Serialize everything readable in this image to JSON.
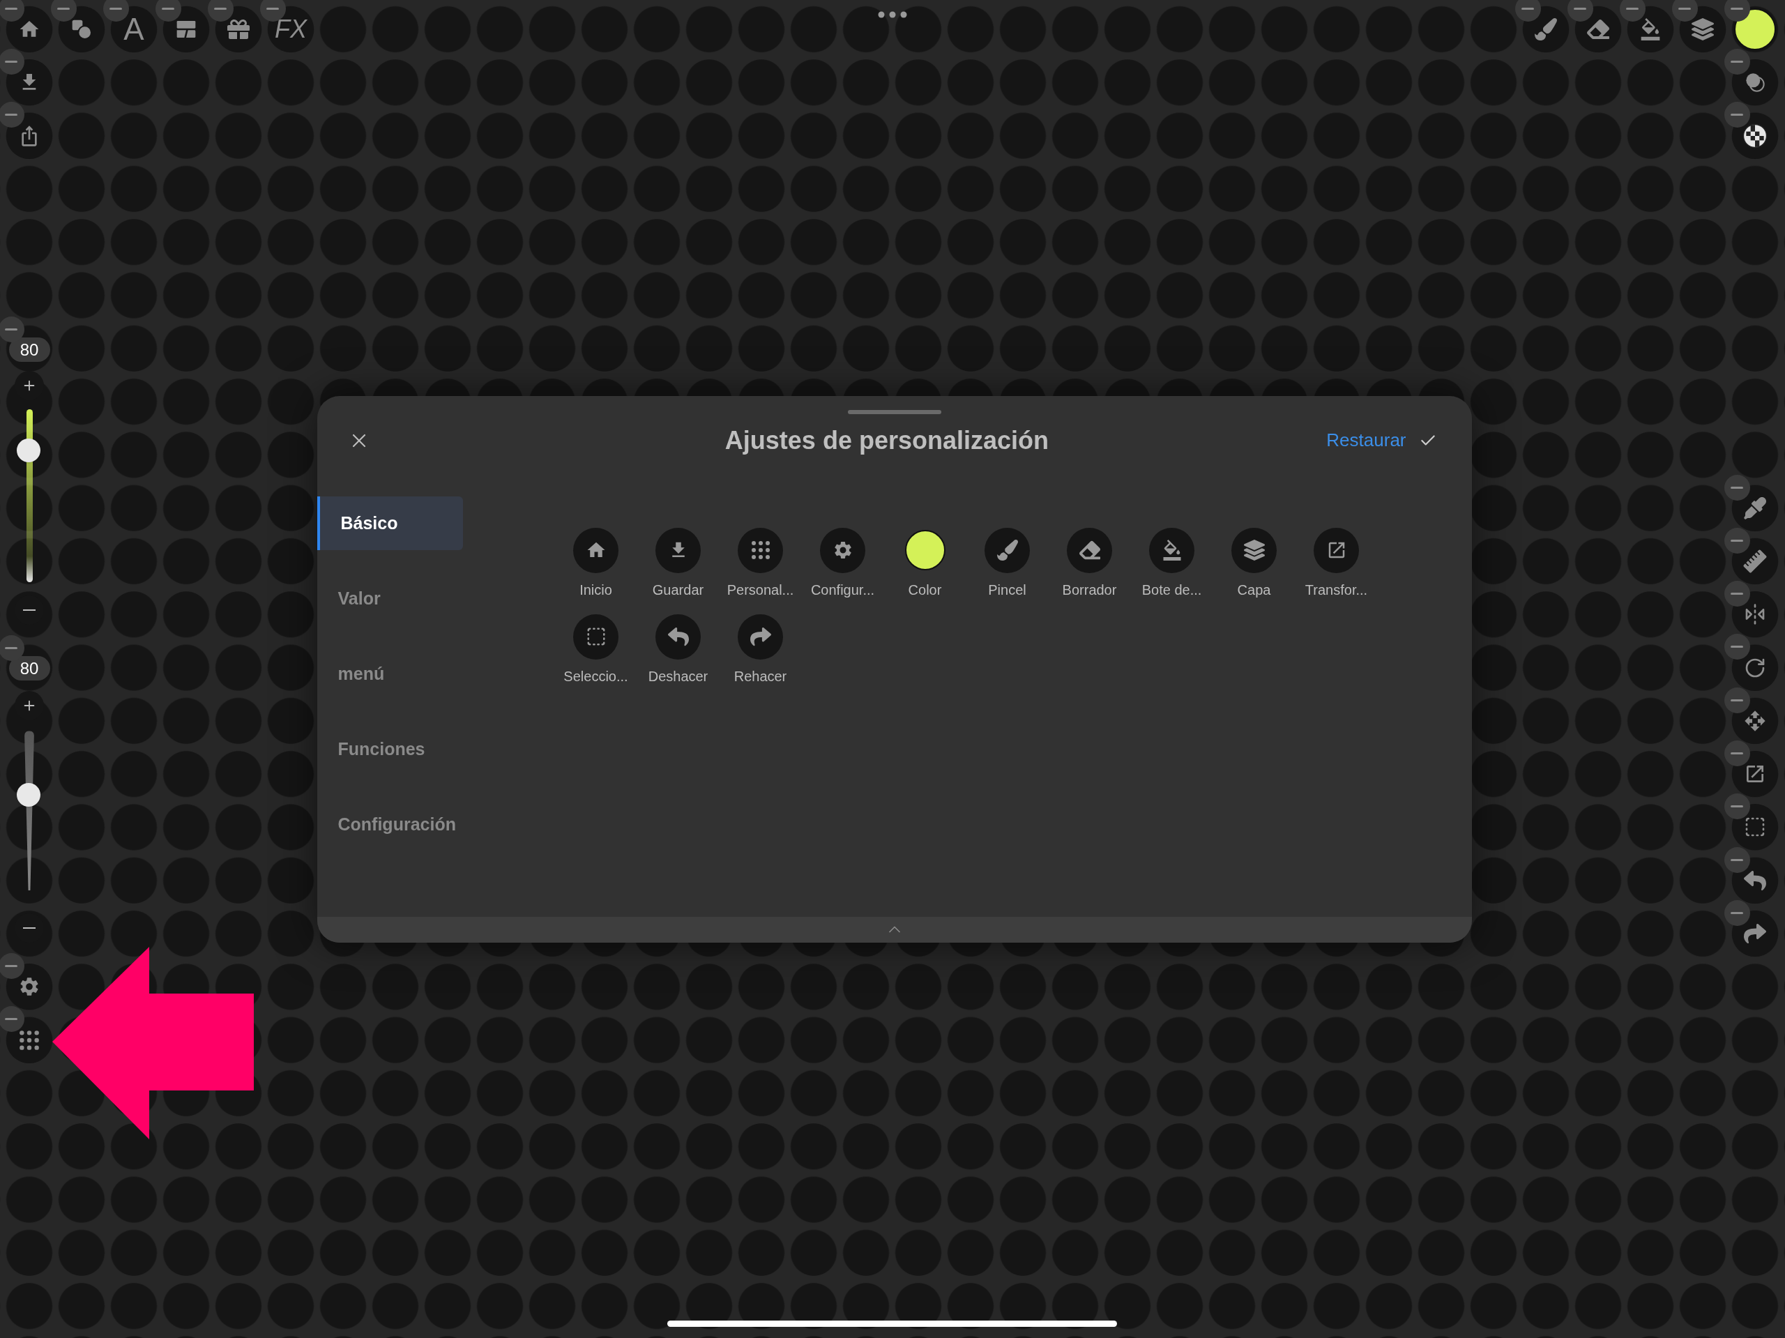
{
  "top_toolbar": {
    "text_tool": "A",
    "effects_tool": "FX",
    "swatch": {
      "color": "#d4f158"
    }
  },
  "left_toolbar": {
    "sliders": [
      {
        "kind": "size",
        "value": "80",
        "level": 0.76
      },
      {
        "kind": "opacity",
        "value": "80",
        "level": 0.6
      }
    ]
  },
  "dialog": {
    "title": "Ajustes de personalización",
    "reset": "Restaurar",
    "sidebar": [
      {
        "label": "Básico",
        "selected": true
      },
      {
        "label": "Valor",
        "selected": false
      },
      {
        "label": "menú",
        "selected": false
      },
      {
        "label": "Funciones",
        "selected": false
      },
      {
        "label": "Configuración",
        "selected": false
      }
    ],
    "items": [
      {
        "kind": "home",
        "label": "Inicio"
      },
      {
        "kind": "save",
        "label": "Guardar"
      },
      {
        "kind": "customize",
        "label": "Personal..."
      },
      {
        "kind": "settings",
        "label": "Configur..."
      },
      {
        "kind": "swatch",
        "label": "Color",
        "color": "#d4f158"
      },
      {
        "kind": "brush",
        "label": "Pincel"
      },
      {
        "kind": "eraser",
        "label": "Borrador"
      },
      {
        "kind": "bucket",
        "label": "Bote de..."
      },
      {
        "kind": "layer",
        "label": "Capa"
      },
      {
        "kind": "transform",
        "label": "Transfor..."
      },
      {
        "kind": "selection",
        "label": "Seleccio..."
      },
      {
        "kind": "undo",
        "label": "Deshacer"
      },
      {
        "kind": "redo",
        "label": "Rehacer"
      }
    ]
  }
}
